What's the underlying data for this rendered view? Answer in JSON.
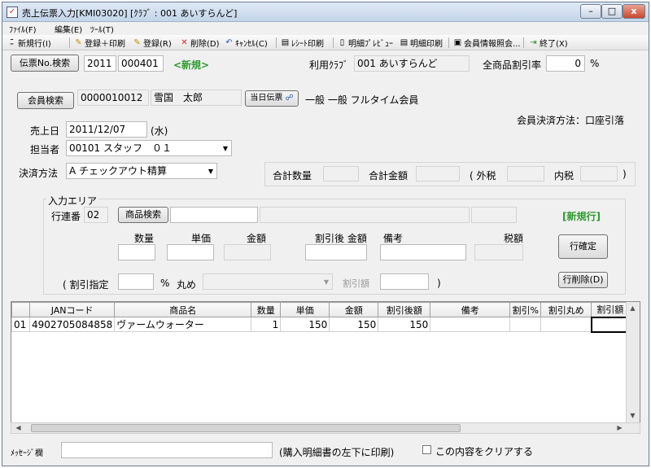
{
  "window": {
    "title": "売上伝票入力[KMI03020] [ｸﾗﾌﾞ : 001 あいすらんど]",
    "minimize": "–",
    "maximize": "□",
    "close": "x"
  },
  "menu": [
    "ﾌｧｲﾙ(F)",
    "編集(E)",
    "ﾂｰﾙ(T)"
  ],
  "toolbar": [
    {
      "label": "新規行(I)",
      "icon": "new-row-icon",
      "glyph": "ﾆ"
    },
    {
      "label": "登録＋印刷",
      "icon": "register-print-icon",
      "glyph": "✎"
    },
    {
      "label": "登録(R)",
      "icon": "register-icon",
      "glyph": "✎"
    },
    {
      "label": "削除(D)",
      "icon": "delete-icon",
      "glyph": "✕"
    },
    {
      "label": "ｷｬﾝｾﾙ(C)",
      "icon": "undo-icon",
      "glyph": "↶"
    },
    {
      "label": "ﾚｼｰﾄ印刷",
      "icon": "receipt-print-icon",
      "glyph": "▤"
    },
    {
      "label": "明細ﾌﾟﾚﾋﾞｭｰ",
      "icon": "preview-icon",
      "glyph": "▯"
    },
    {
      "label": "明細印刷",
      "icon": "print-icon",
      "glyph": "▤"
    },
    {
      "label": "会員情報照会...",
      "icon": "member-info-icon",
      "glyph": "▣"
    },
    {
      "label": "終了(X)",
      "icon": "exit-icon",
      "glyph": "⇥"
    }
  ],
  "header": {
    "slip_search_label": "伝票No.検索",
    "slip_year": "2011",
    "slip_no": "000401",
    "slip_status": "<新規>",
    "club_label": "利用ｸﾗﾌﾞ",
    "club_value": "001 あいすらんど",
    "discount_label": "全商品割引率",
    "discount_value": "0",
    "discount_unit": "%"
  },
  "member": {
    "search_label": "会員検索",
    "member_no": "0000010012",
    "member_name": "雪国　太郎",
    "today_slip_label": "当日伝票",
    "today_slip_icon": "binoculars-icon",
    "member_type": "一般 一般 フルタイム会員",
    "payment_method": "会員決済方法：口座引落"
  },
  "sale": {
    "date_label": "売上日",
    "date_value": "2011/12/07",
    "weekday": "(水)",
    "staff_label": "担当者",
    "staff_value": "00101 スタッフ　０１",
    "payment_label": "決済方法",
    "payment_value": "A チェックアウト精算"
  },
  "totals": {
    "qty_label": "合計数量",
    "amount_label": "合計金額",
    "outer_tax_label": "( 外税",
    "inner_tax_label": "内税",
    "close_paren": ")"
  },
  "input_area": {
    "title": "入力エリア",
    "row_seq_label": "行連番",
    "row_seq_value": "02",
    "product_search_label": "商品検索",
    "new_row_label": "[新規行]",
    "qty_label": "数量",
    "unit_price_label": "単価",
    "amount_label": "金額",
    "discounted_amount_label": "割引後 金額",
    "memo_label": "備考",
    "tax_label": "税額",
    "confirm_row_label": "行確定",
    "discount_spec_label": "( 割引指定",
    "percent": "%",
    "rounding_label": "丸め",
    "discount_amount_label": "割引額",
    "close_paren": ")",
    "delete_row_label": "行削除(D)"
  },
  "grid": {
    "columns": [
      "",
      "JANコード",
      "商品名",
      "数量",
      "単価",
      "金額",
      "割引後額",
      "備考",
      "割引%",
      "割引丸め",
      "割引額"
    ],
    "rows": [
      [
        "01",
        "4902705084858",
        "ヴァームウォーター",
        "1",
        "150",
        "150",
        "150",
        "",
        "",
        "",
        ""
      ]
    ]
  },
  "footer": {
    "message_label": "ﾒｯｾｰｼﾞ欄",
    "message_value": "",
    "print_note": "(購入明細書の左下に印刷)",
    "clear_checkbox_label": "この内容をクリアする",
    "clear_checked": false
  }
}
